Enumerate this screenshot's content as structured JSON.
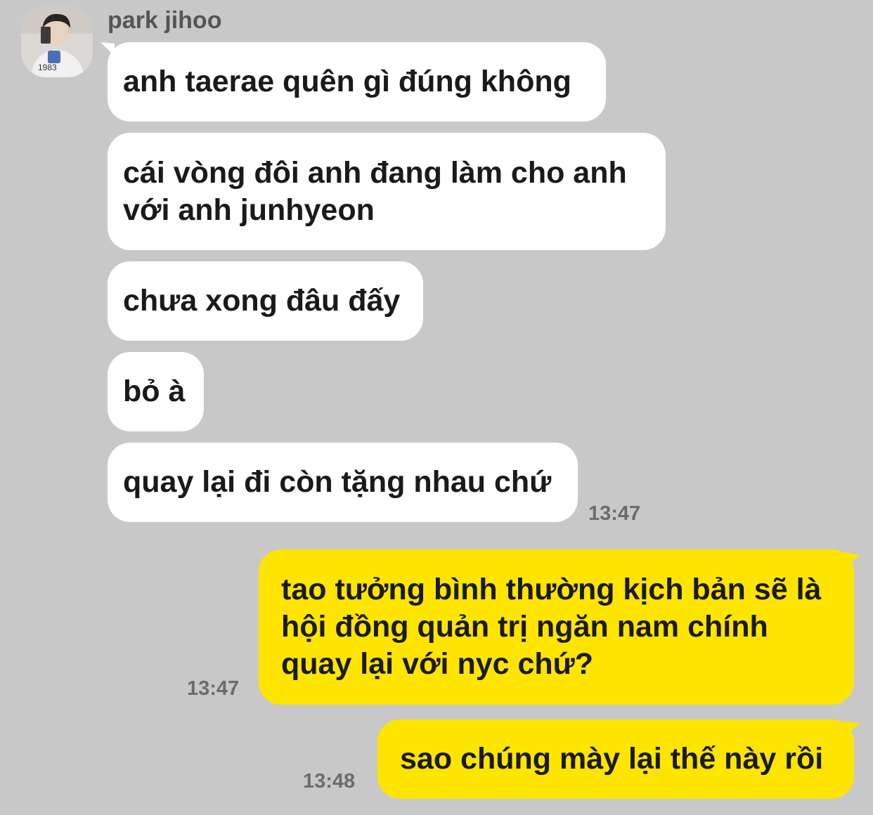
{
  "chat": {
    "sender_name": "park jihoo",
    "avatar_caption": "1983",
    "incoming": [
      "anh taerae quên gì đúng không",
      "cái vòng đôi anh đang làm cho anh\nvới anh junhyeon",
      "chưa xong đâu đấy",
      "bỏ à",
      "quay lại đi còn tặng nhau chứ"
    ],
    "incoming_time": "13:47",
    "outgoing": [
      {
        "text": "tao tưởng bình thường kịch bản sẽ là\nhội đồng quản trị ngăn nam chính\nquay lại với nyc chứ?",
        "time": "13:47"
      },
      {
        "text": "sao chúng mày lại thế này rồi",
        "time": "13:48"
      }
    ]
  },
  "colors": {
    "background": "#c8c8c8",
    "incoming_bubble": "#ffffff",
    "outgoing_bubble": "#fee500",
    "timestamp": "#6c6c6c"
  }
}
